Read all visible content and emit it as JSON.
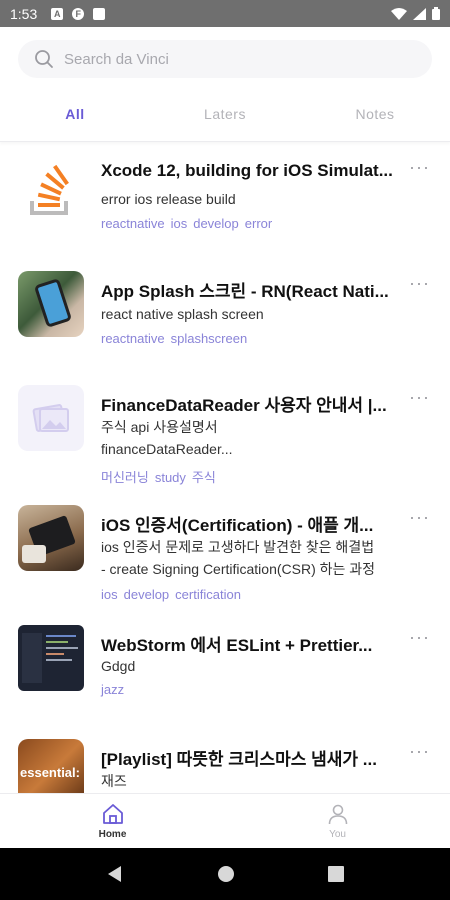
{
  "status_bar": {
    "time": "1:53",
    "icons": [
      "a-icon",
      "f-icon",
      "doc-icon"
    ],
    "right_icons": [
      "wifi-icon",
      "signal-icon",
      "battery-icon"
    ]
  },
  "search": {
    "placeholder": "Search da Vinci",
    "icon": "search-icon"
  },
  "tabs": [
    {
      "label": "All",
      "active": true
    },
    {
      "label": "Laters",
      "active": false
    },
    {
      "label": "Notes",
      "active": false
    }
  ],
  "items": [
    {
      "title": "Xcode 12, building for iOS Simulat...",
      "desc": [
        "error ios release build"
      ],
      "tags": [
        "reactnative",
        "ios",
        "develop",
        "error"
      ],
      "thumb": "stackoverflow-logo"
    },
    {
      "title": "App Splash 스크린 - RN(React Nati...",
      "desc": [
        "react native splash screen"
      ],
      "tags": [
        "reactnative",
        "splashscreen"
      ],
      "thumb": "phone-photo"
    },
    {
      "title": "FinanceDataReader 사용자 안내서 |...",
      "desc": [
        "주식 api 사용설명서",
        "financeDataReader..."
      ],
      "tags": [
        "머신러닝",
        "study",
        "주식"
      ],
      "thumb": "image-placeholder-icon"
    },
    {
      "title": "iOS 인증서(Certification) - 애플 개...",
      "desc": [
        "ios 인증서 문제로 고생하다 발견한 찾은 해결법",
        "- create Signing Certification(CSR) 하는 과정"
      ],
      "tags": [
        "ios",
        "develop",
        "certification"
      ],
      "thumb": "tablet-photo"
    },
    {
      "title": "WebStorm 에서 ESLint + Prettier...",
      "desc": [
        "Gdgd"
      ],
      "tags": [
        "jazz"
      ],
      "thumb": "code-editor-screenshot"
    },
    {
      "title": "[Playlist] 따뜻한 크리스마스 냄새가 ...",
      "desc": [
        "재즈"
      ],
      "tags": [],
      "thumb": "essential-playlist-cover",
      "thumb_text": "essential:"
    }
  ],
  "more_label": "···",
  "bottom_nav": [
    {
      "label": "Home",
      "icon": "home-icon",
      "active": true
    },
    {
      "label": "You",
      "icon": "person-icon",
      "active": false
    }
  ],
  "colors": {
    "accent": "#6a5bd6",
    "tag": "#8a84d8",
    "status_bar": "#6f6f6f"
  }
}
